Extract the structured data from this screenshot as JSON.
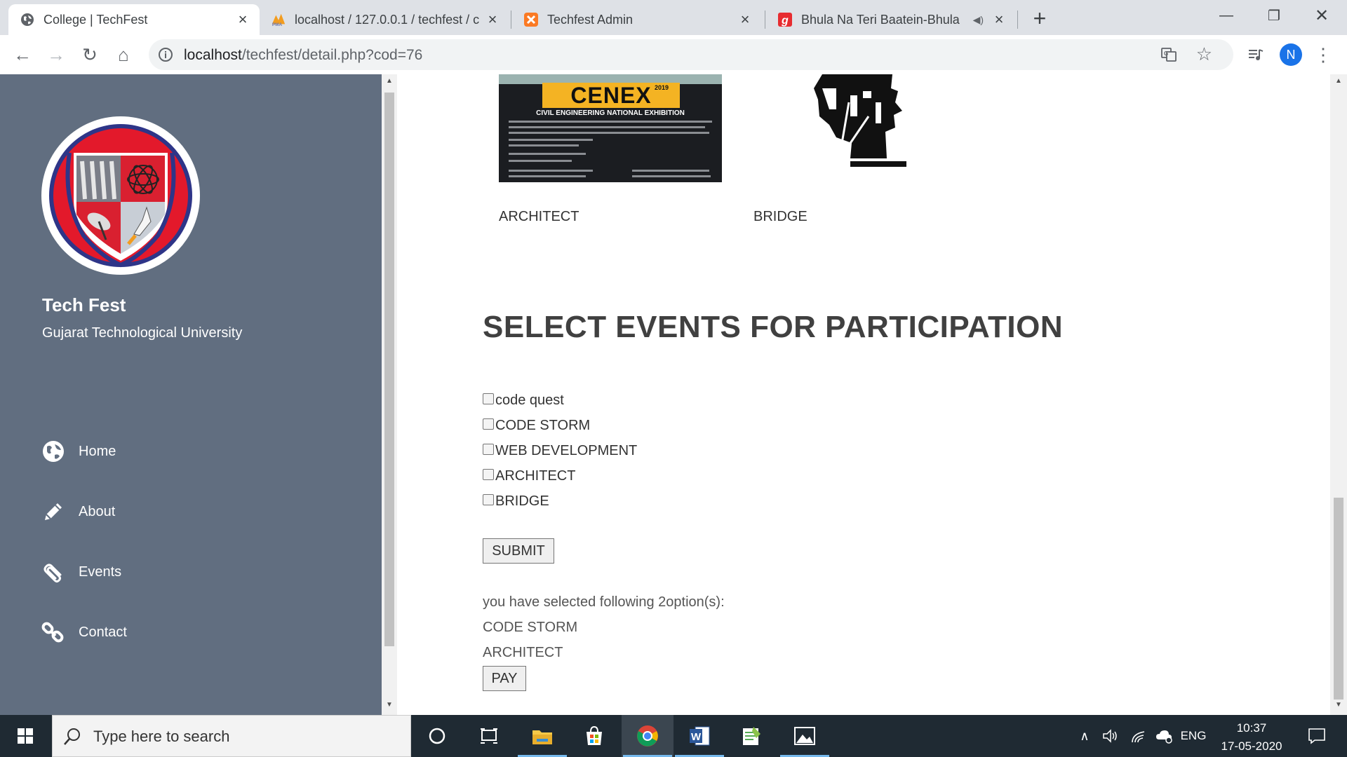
{
  "browser": {
    "tabs": [
      {
        "title": "College | TechFest",
        "active": true
      },
      {
        "title": "localhost / 127.0.0.1 / techfest / c",
        "active": false
      },
      {
        "title": "Techfest Admin",
        "active": false
      },
      {
        "title": "Bhula Na Teri Baatein-Bhula",
        "active": false
      }
    ],
    "url_host": "localhost",
    "url_path": "/techfest/detail.php?cod=76",
    "profile_initial": "N"
  },
  "sidebar": {
    "title": "Tech Fest",
    "subtitle": "Gujarat Technological University",
    "nav": [
      {
        "label": "Home",
        "icon": "globe-icon"
      },
      {
        "label": "About",
        "icon": "pencil-icon"
      },
      {
        "label": "Events",
        "icon": "paperclip-icon"
      },
      {
        "label": "Contact",
        "icon": "link-icon"
      }
    ]
  },
  "gallery": {
    "poster_title": "CENEX",
    "poster_year": "2019",
    "poster_subtitle": "CIVIL ENGINEERING NATIONAL EXHIBITION",
    "captions": [
      "ARCHITECT",
      "BRIDGE"
    ]
  },
  "form": {
    "heading": "SELECT EVENTS FOR PARTICIPATION",
    "options": [
      "code quest",
      "CODE STORM",
      "WEB DEVELOPMENT",
      "ARCHITECT",
      "BRIDGE"
    ],
    "submit_label": "SUBMIT",
    "selected_message": "you have selected following 2option(s):",
    "selected": [
      "CODE STORM",
      "ARCHITECT"
    ],
    "pay_label": "PAY"
  },
  "taskbar": {
    "search_placeholder": "Type here to search",
    "language": "ENG",
    "time": "10:37",
    "date": "17-05-2020"
  }
}
